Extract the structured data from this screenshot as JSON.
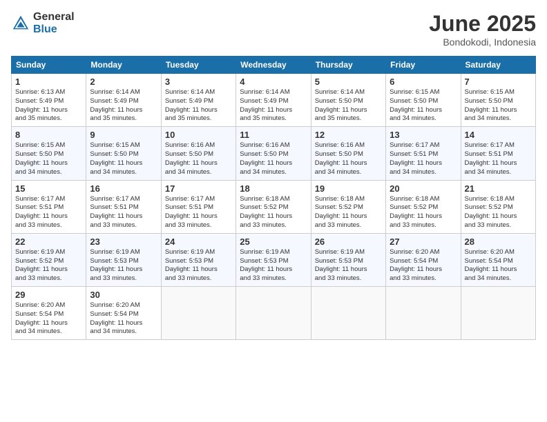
{
  "logo": {
    "general": "General",
    "blue": "Blue"
  },
  "title": "June 2025",
  "subtitle": "Bondokodi, Indonesia",
  "headers": [
    "Sunday",
    "Monday",
    "Tuesday",
    "Wednesday",
    "Thursday",
    "Friday",
    "Saturday"
  ],
  "weeks": [
    [
      {
        "day": "1",
        "info": "Sunrise: 6:13 AM\nSunset: 5:49 PM\nDaylight: 11 hours\nand 35 minutes."
      },
      {
        "day": "2",
        "info": "Sunrise: 6:14 AM\nSunset: 5:49 PM\nDaylight: 11 hours\nand 35 minutes."
      },
      {
        "day": "3",
        "info": "Sunrise: 6:14 AM\nSunset: 5:49 PM\nDaylight: 11 hours\nand 35 minutes."
      },
      {
        "day": "4",
        "info": "Sunrise: 6:14 AM\nSunset: 5:49 PM\nDaylight: 11 hours\nand 35 minutes."
      },
      {
        "day": "5",
        "info": "Sunrise: 6:14 AM\nSunset: 5:50 PM\nDaylight: 11 hours\nand 35 minutes."
      },
      {
        "day": "6",
        "info": "Sunrise: 6:15 AM\nSunset: 5:50 PM\nDaylight: 11 hours\nand 34 minutes."
      },
      {
        "day": "7",
        "info": "Sunrise: 6:15 AM\nSunset: 5:50 PM\nDaylight: 11 hours\nand 34 minutes."
      }
    ],
    [
      {
        "day": "8",
        "info": "Sunrise: 6:15 AM\nSunset: 5:50 PM\nDaylight: 11 hours\nand 34 minutes."
      },
      {
        "day": "9",
        "info": "Sunrise: 6:15 AM\nSunset: 5:50 PM\nDaylight: 11 hours\nand 34 minutes."
      },
      {
        "day": "10",
        "info": "Sunrise: 6:16 AM\nSunset: 5:50 PM\nDaylight: 11 hours\nand 34 minutes."
      },
      {
        "day": "11",
        "info": "Sunrise: 6:16 AM\nSunset: 5:50 PM\nDaylight: 11 hours\nand 34 minutes."
      },
      {
        "day": "12",
        "info": "Sunrise: 6:16 AM\nSunset: 5:50 PM\nDaylight: 11 hours\nand 34 minutes."
      },
      {
        "day": "13",
        "info": "Sunrise: 6:17 AM\nSunset: 5:51 PM\nDaylight: 11 hours\nand 34 minutes."
      },
      {
        "day": "14",
        "info": "Sunrise: 6:17 AM\nSunset: 5:51 PM\nDaylight: 11 hours\nand 34 minutes."
      }
    ],
    [
      {
        "day": "15",
        "info": "Sunrise: 6:17 AM\nSunset: 5:51 PM\nDaylight: 11 hours\nand 33 minutes."
      },
      {
        "day": "16",
        "info": "Sunrise: 6:17 AM\nSunset: 5:51 PM\nDaylight: 11 hours\nand 33 minutes."
      },
      {
        "day": "17",
        "info": "Sunrise: 6:17 AM\nSunset: 5:51 PM\nDaylight: 11 hours\nand 33 minutes."
      },
      {
        "day": "18",
        "info": "Sunrise: 6:18 AM\nSunset: 5:52 PM\nDaylight: 11 hours\nand 33 minutes."
      },
      {
        "day": "19",
        "info": "Sunrise: 6:18 AM\nSunset: 5:52 PM\nDaylight: 11 hours\nand 33 minutes."
      },
      {
        "day": "20",
        "info": "Sunrise: 6:18 AM\nSunset: 5:52 PM\nDaylight: 11 hours\nand 33 minutes."
      },
      {
        "day": "21",
        "info": "Sunrise: 6:18 AM\nSunset: 5:52 PM\nDaylight: 11 hours\nand 33 minutes."
      }
    ],
    [
      {
        "day": "22",
        "info": "Sunrise: 6:19 AM\nSunset: 5:52 PM\nDaylight: 11 hours\nand 33 minutes."
      },
      {
        "day": "23",
        "info": "Sunrise: 6:19 AM\nSunset: 5:53 PM\nDaylight: 11 hours\nand 33 minutes."
      },
      {
        "day": "24",
        "info": "Sunrise: 6:19 AM\nSunset: 5:53 PM\nDaylight: 11 hours\nand 33 minutes."
      },
      {
        "day": "25",
        "info": "Sunrise: 6:19 AM\nSunset: 5:53 PM\nDaylight: 11 hours\nand 33 minutes."
      },
      {
        "day": "26",
        "info": "Sunrise: 6:19 AM\nSunset: 5:53 PM\nDaylight: 11 hours\nand 33 minutes."
      },
      {
        "day": "27",
        "info": "Sunrise: 6:20 AM\nSunset: 5:54 PM\nDaylight: 11 hours\nand 33 minutes."
      },
      {
        "day": "28",
        "info": "Sunrise: 6:20 AM\nSunset: 5:54 PM\nDaylight: 11 hours\nand 34 minutes."
      }
    ],
    [
      {
        "day": "29",
        "info": "Sunrise: 6:20 AM\nSunset: 5:54 PM\nDaylight: 11 hours\nand 34 minutes."
      },
      {
        "day": "30",
        "info": "Sunrise: 6:20 AM\nSunset: 5:54 PM\nDaylight: 11 hours\nand 34 minutes."
      },
      null,
      null,
      null,
      null,
      null
    ]
  ]
}
